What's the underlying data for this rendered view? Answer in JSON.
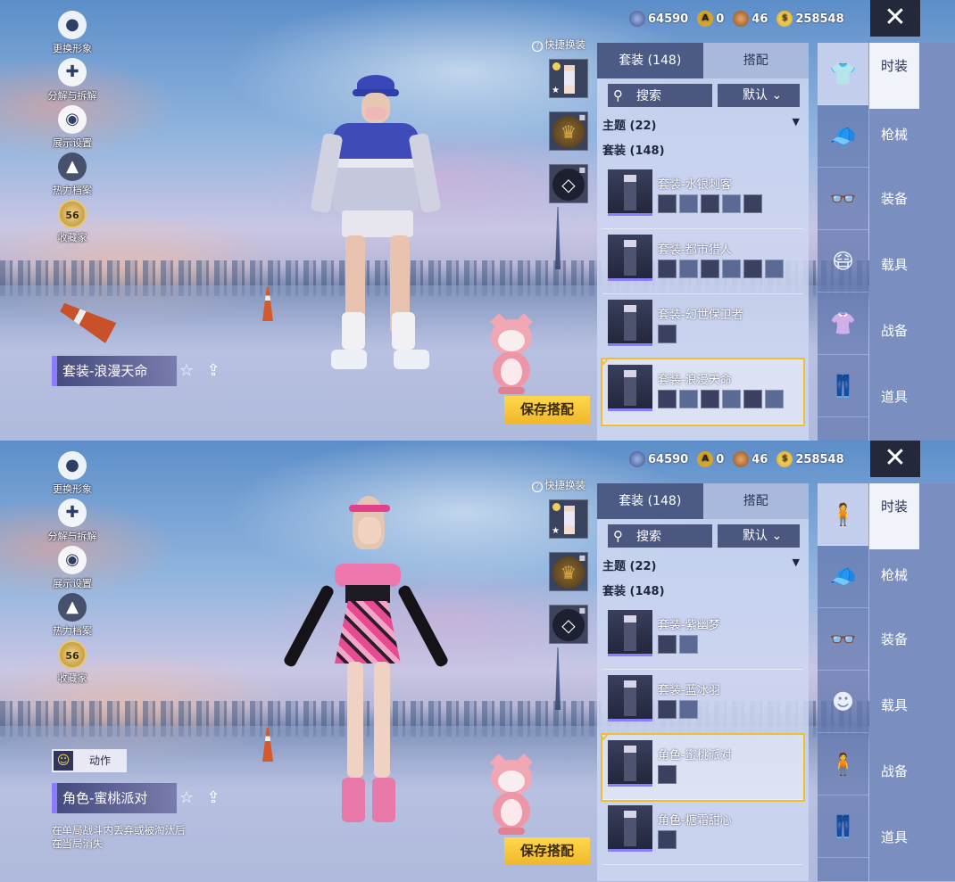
{
  "currency": {
    "silver": "64590",
    "ag": "0",
    "bronze": "46",
    "uc": "258548"
  },
  "close_icon": "close-icon",
  "left_menu": [
    {
      "label": "更换形象",
      "icon": "avatar-icon"
    },
    {
      "label": "分解与拆解",
      "icon": "puzzle-icon"
    },
    {
      "label": "展示设置",
      "icon": "eye-icon"
    },
    {
      "label": "热力档案",
      "icon": "fire-icon"
    },
    {
      "label": "收藏家",
      "icon": "collector-badge-icon",
      "badge": "56"
    }
  ],
  "quick_change": "快捷换装",
  "save_button": "保存搭配",
  "list": {
    "tab_suits": "套装 (148)",
    "tab_match": "搭配",
    "search": "搜索",
    "sort": "默认",
    "theme": "主题 (22)",
    "suit_count": "套装 (148)"
  },
  "side_tabs": [
    "时装",
    "枪械",
    "装备",
    "载具",
    "战备",
    "道具"
  ],
  "panel1": {
    "outfit_label": "套装-浪漫天命",
    "items": [
      {
        "name": "套装-水银刺客",
        "parts": 5,
        "selected": false
      },
      {
        "name": "套装-都市猎人",
        "parts": 6,
        "selected": false
      },
      {
        "name": "套装-幻世保卫者",
        "parts": 1,
        "selected": false
      },
      {
        "name": "套装-浪漫天命",
        "parts": 6,
        "selected": true
      }
    ]
  },
  "panel2": {
    "outfit_label": "角色-蜜桃派对",
    "action_label": "动作",
    "note_line1": "在单局战斗内丢弃或被淘汰后",
    "note_line2": "在当局消失",
    "items": [
      {
        "name": "套装-紫幽梦",
        "parts": 2,
        "selected": false
      },
      {
        "name": "套装-蓝冰羽",
        "parts": 2,
        "selected": false
      },
      {
        "name": "角色-蜜桃派对",
        "parts": 1,
        "selected": true
      },
      {
        "name": "角色-糖霜甜心",
        "parts": 1,
        "selected": false
      }
    ]
  },
  "colors": {
    "accent": "#f0bf31",
    "tab_active": "#4c5a86",
    "purple": "#8a7dff"
  }
}
